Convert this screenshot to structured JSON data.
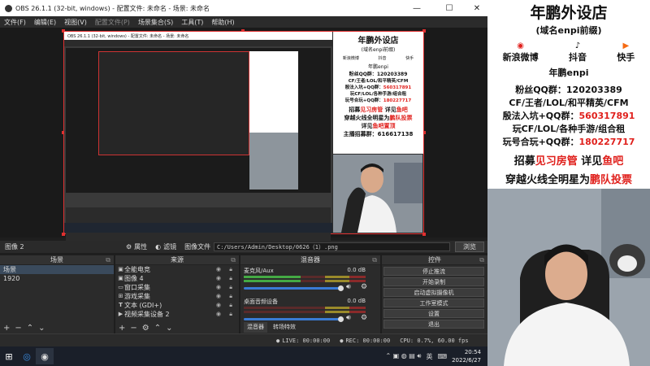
{
  "window": {
    "title": "OBS 26.1.1 (32-bit, windows) - 配置文件: 未命名 - 场景: 未命名"
  },
  "menu": [
    "文件(F)",
    "编辑(E)",
    "视图(V)",
    "配置文件(P)",
    "场景集合(S)",
    "工具(T)",
    "帮助(H)"
  ],
  "properties_bar": {
    "source_name": "图像 2",
    "properties_label": "属性",
    "filters_label": "滤镜",
    "image_file_label": "图像文件",
    "path": "C:/Users/Admin/Desktop/0626（1）.png",
    "browse_label": "浏览"
  },
  "scenes": {
    "header": "场景",
    "items": [
      "场景",
      "1920"
    ]
  },
  "sources": {
    "header": "来源",
    "items": [
      {
        "icon": "image-icon",
        "label": "全能电竞"
      },
      {
        "icon": "image-icon",
        "label": "图像 4"
      },
      {
        "icon": "window-capture-icon",
        "label": "窗口采集"
      },
      {
        "icon": "game-capture-icon",
        "label": "游戏采集"
      },
      {
        "icon": "text-icon",
        "label": "文本 (GDI+)"
      },
      {
        "icon": "camera-icon",
        "label": "视频采集设备 2"
      }
    ]
  },
  "mixer": {
    "header": "混音器",
    "tracks": [
      {
        "name": "麦克风/Aux",
        "db": "0.0 dB",
        "level": 0.7
      },
      {
        "name": "桌面音频设备",
        "db": "0.0 dB",
        "level": 0.0
      }
    ],
    "tabs": [
      "混音器",
      "转场特效"
    ]
  },
  "controls": {
    "header": "控件",
    "buttons": [
      "停止推流",
      "开始录制",
      "启动虚拟摄像机",
      "工作室模式",
      "设置",
      "退出"
    ]
  },
  "status": {
    "live": "LIVE: 00:00:00",
    "rec": "REC: 00:00:00",
    "cpu": "CPU: 0.7%, 60.00 fps"
  },
  "taskbar": {
    "time": "20:54",
    "date": "2022/6/27",
    "lang": "英"
  },
  "promo": {
    "title": "年鹏外设店",
    "subtitle": "(域名enpi前缀)",
    "socials": [
      "新浪微博",
      "抖音",
      "快手"
    ],
    "name": "年鹏enpi",
    "qq_label": "粉丝QQ群：",
    "qq": "120203389",
    "line1": "CF/王者/LOL/和平精英/CFM",
    "line2_label": "殷法入坑+QQ群：",
    "line2_num": "560317891",
    "line3": "玩CF/LOL/各种手游/组合租",
    "line4_label": "玩号合玩+QQ群：",
    "line4_num": "180227717",
    "line5_a": "招募",
    "line5_b": "见习房管",
    "line5_c": " 详见",
    "line5_d": "鱼吧",
    "line6_a": "穿越火线全明星为",
    "line6_b": "鹏队投票",
    "line7_a": "详见",
    "line7_b": "鱼吧置顶",
    "line8_label": "主播招募群：",
    "line8_num": "616617138"
  }
}
